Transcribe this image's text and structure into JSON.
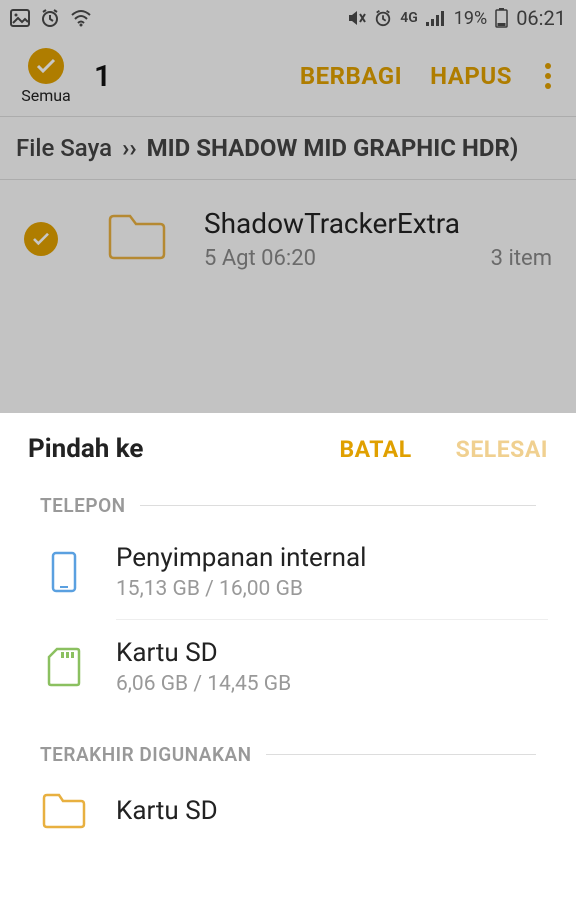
{
  "status": {
    "battery_pct": "19%",
    "time": "06:21",
    "network": "4G"
  },
  "action_bar": {
    "select_all_label": "Semua",
    "count": "1",
    "share": "BERBAGI",
    "delete": "HAPUS"
  },
  "breadcrumb": {
    "root": "File Saya",
    "path": "MID SHADOW  MID GRAPHIC  HDR)"
  },
  "file": {
    "name": "ShadowTrackerExtra",
    "date": "5 Agt 06:20",
    "items": "3 item"
  },
  "sheet": {
    "title": "Pindah ke",
    "cancel": "BATAL",
    "done": "SELESAI",
    "section_phone": "TELEPON",
    "section_recent": "TERAKHIR DIGUNAKAN",
    "internal": {
      "name": "Penyimpanan internal",
      "usage": "15,13 GB / 16,00 GB"
    },
    "sdcard": {
      "name": "Kartu SD",
      "usage": "6,06 GB / 14,45 GB"
    },
    "recent_sd": {
      "name": "Kartu SD"
    }
  }
}
